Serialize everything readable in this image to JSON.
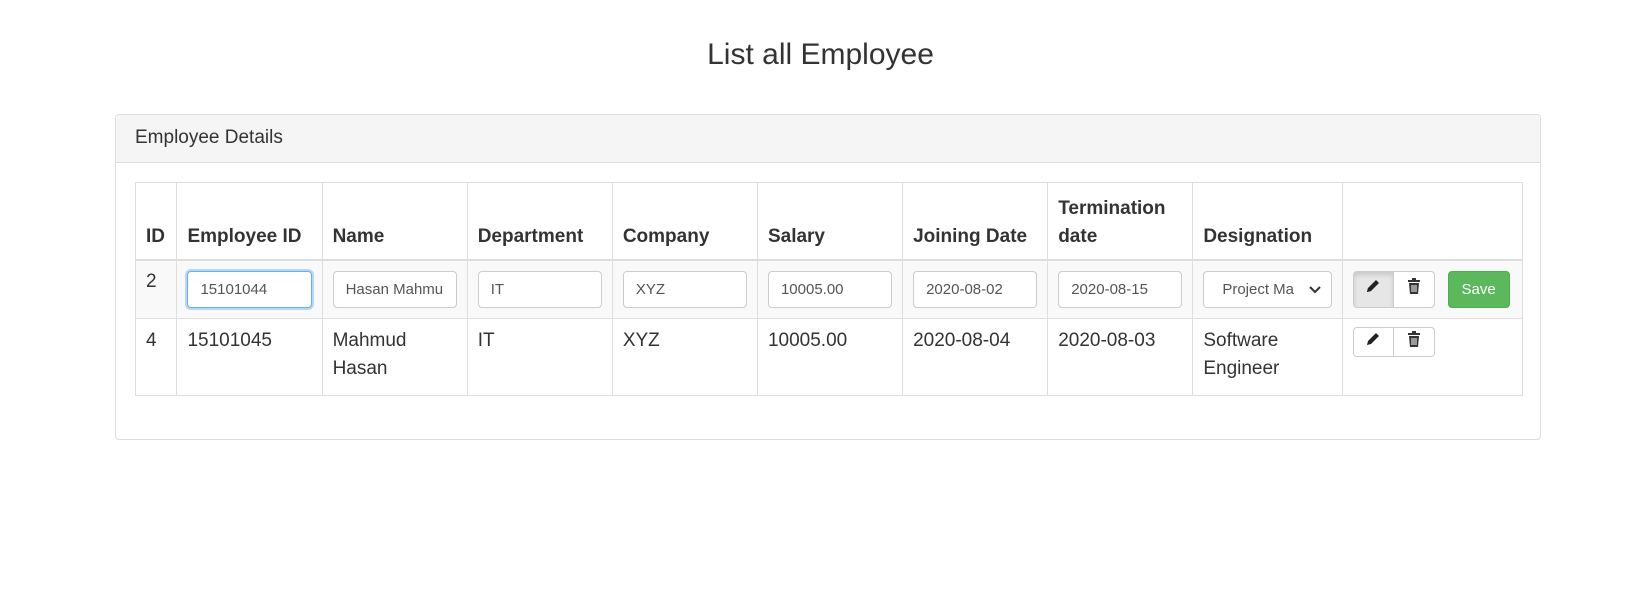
{
  "page": {
    "title": "List all Employee"
  },
  "panel": {
    "heading": "Employee Details"
  },
  "table": {
    "headers": [
      "ID",
      "Employee ID",
      "Name",
      "Department",
      "Company",
      "Salary",
      "Joining Date",
      "Termination date",
      "Designation",
      ""
    ],
    "edit_row": {
      "id": "2",
      "employee_id": "15101044",
      "name": "Hasan Mahmu",
      "department": "IT",
      "company": "XYZ",
      "salary": "10005.00",
      "joining_date": "2020-08-02",
      "termination_date": "2020-08-15",
      "designation": "Project Ma",
      "save_label": "Save"
    },
    "rows": [
      {
        "id": "4",
        "employee_id": "15101045",
        "name": "Mahmud Hasan",
        "department": "IT",
        "company": "XYZ",
        "salary": "10005.00",
        "joining_date": "2020-08-04",
        "termination_date": "2020-08-03",
        "designation": "Software Engineer"
      }
    ]
  },
  "colors": {
    "save_button": "#5cb85c",
    "focus_border": "#66afe9",
    "panel_heading_bg": "#f5f5f5"
  },
  "icons": [
    "pencil-icon",
    "trash-icon",
    "chevron-down-icon"
  ]
}
